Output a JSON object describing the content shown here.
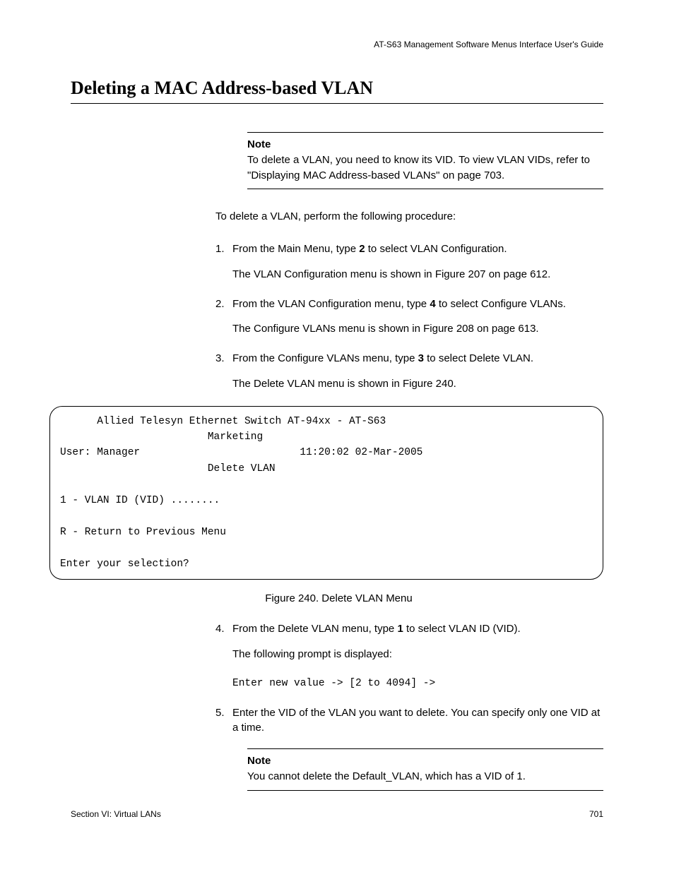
{
  "header": {
    "guide": "AT-S63 Management Software Menus Interface User's Guide"
  },
  "title": "Deleting a MAC Address-based VLAN",
  "notes": [
    {
      "label": "Note",
      "text": "To delete a VLAN, you need to know its VID. To view VLAN VIDs, refer to \"Displaying MAC Address-based VLANs\" on page 703."
    },
    {
      "label": "Note",
      "text": "You cannot delete the Default_VLAN, which has a VID of 1."
    }
  ],
  "intro": "To delete a VLAN, perform the following procedure:",
  "steps": [
    {
      "num": "1.",
      "text_before": "From the Main Menu, type ",
      "bold": "2",
      "text_after": " to select VLAN Configuration.",
      "sub": "The VLAN Configuration menu is shown in Figure 207 on page 612."
    },
    {
      "num": "2.",
      "text_before": "From the VLAN Configuration menu, type ",
      "bold": "4",
      "text_after": " to select Configure VLANs.",
      "sub": "The Configure VLANs menu is shown in Figure 208 on page 613."
    },
    {
      "num": "3.",
      "text_before": "From the Configure VLANs menu, type ",
      "bold": "3",
      "text_after": " to select Delete VLAN.",
      "sub": "The Delete VLAN menu is shown in Figure 240."
    },
    {
      "num": "4.",
      "text_before": "From the Delete VLAN menu, type ",
      "bold": "1",
      "text_after": " to select VLAN ID (VID).",
      "sub": "The following prompt is displayed:"
    },
    {
      "num": "5.",
      "text_before": "Enter the VID of the VLAN you want to delete. You can specify only one VID at a time.",
      "bold": "",
      "text_after": "",
      "sub": ""
    }
  ],
  "terminal": {
    "line1": "      Allied Telesyn Ethernet Switch AT-94xx - AT-S63",
    "line2": "                        Marketing",
    "line3": "User: Manager                          11:20:02 02-Mar-2005",
    "line4": "                        Delete VLAN",
    "line5": "",
    "line6": "1 - VLAN ID (VID) ........",
    "line7": "",
    "line8": "R - Return to Previous Menu",
    "line9": "",
    "line10": "Enter your selection?"
  },
  "figure_caption": "Figure 240. Delete VLAN Menu",
  "prompt_mono": "Enter new value -> [2 to 4094] ->",
  "footer": {
    "section": "Section VI: Virtual LANs",
    "page": "701"
  }
}
